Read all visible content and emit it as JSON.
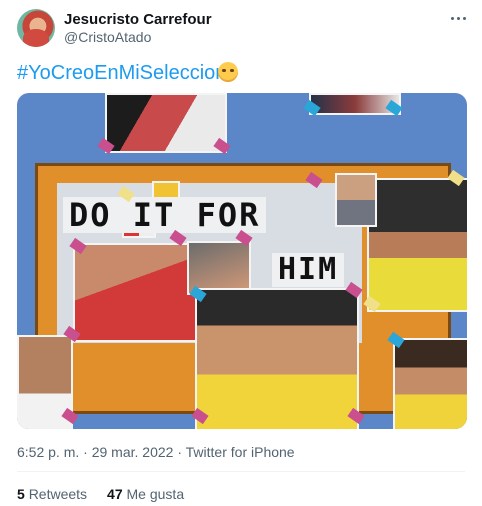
{
  "user": {
    "name": "Jesucristo Carrefour",
    "handle": "@CristoAtado"
  },
  "tweet": {
    "hashtag": "#YoCreoEnMiSeleccion",
    "emoji": "smiling-face-emoji"
  },
  "media": {
    "sign_line1": "DO IT FOR",
    "sign_line2": "HIM"
  },
  "meta": {
    "time": "6:52 p. m.",
    "date": "29 mar. 2022",
    "source": "Twitter for iPhone",
    "separator": "·"
  },
  "stats": {
    "retweets_count": "5",
    "retweets_label": "Retweets",
    "likes_count": "47",
    "likes_label": "Me gusta"
  },
  "icons": {
    "more": "more-horizontal-icon"
  },
  "colors": {
    "link": "#1d9bf0",
    "secondary_text": "#536471",
    "board_blue": "#5b86c7",
    "board_orange": "#e08f2b"
  }
}
